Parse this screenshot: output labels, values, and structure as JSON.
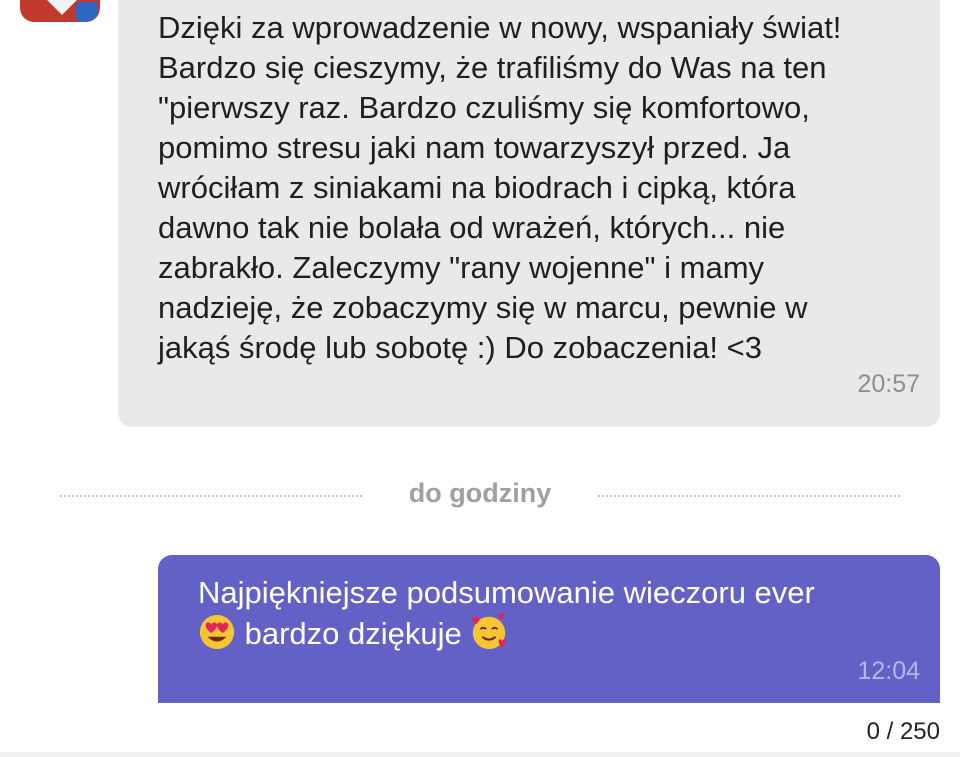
{
  "conversation": {
    "incoming": {
      "text": "Dzięki za wprowadzenie w nowy, wspaniały świat!\nBardzo się cieszymy, że trafiliśmy do Was na ten\n\"pierwszy raz. Bardzo czuliśmy się komfortowo,\npomimo stresu jaki nam towarzyszył przed. Ja\nwróciłam z siniakami na biodrach i cipką, która\ndawno tak nie bolała od wrażeń, których... nie\nzabrakło. Zaleczymy \"rany wojenne\" i mamy\nnadzieję, że zobaczymy się w marcu, pewnie w\njakąś środę lub sobotę :) Do zobaczenia! <3",
      "time": "20:57"
    },
    "divider": {
      "label": "do godziny"
    },
    "outgoing": {
      "text_part1": "Najpiękniejsze podsumowanie wieczoru ever",
      "text_part2": " bardzo dziękuje ",
      "emoji_1": "smiling-face-with-heart-eyes",
      "emoji_2": "smiling-face-with-hearts",
      "time": "12:04"
    }
  },
  "composer": {
    "char_counter": "0 / 250"
  },
  "colors": {
    "incoming_bubble": "#e9e9e9",
    "outgoing_bubble": "#6361c6",
    "timestamp_in": "#8e8e8e",
    "timestamp_out": "#b7b5ec",
    "divider_text": "#a0a0a0"
  }
}
